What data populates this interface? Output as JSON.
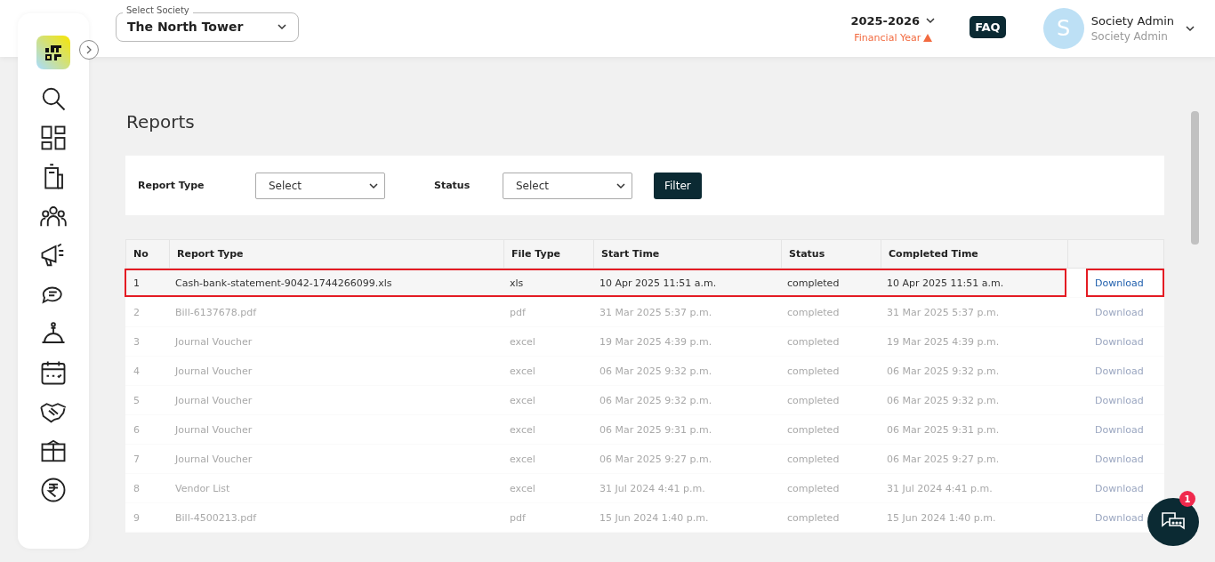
{
  "header": {
    "society_label": "Select Society",
    "society_value": "The North Tower",
    "year": "2025-2026",
    "year_caption": "Financial Year",
    "faq": "FAQ",
    "avatar_letter": "S",
    "user_name": "Society Admin",
    "user_role": "Society Admin"
  },
  "page_title": "Reports",
  "filters": [
    {
      "label": "Report Type",
      "placeholder": "Select"
    },
    {
      "label": "Status",
      "placeholder": "Select"
    }
  ],
  "filter_button": "Filter",
  "table": {
    "columns": [
      "No",
      "Report Type",
      "File Type",
      "Start Time",
      "Status",
      "Completed Time"
    ],
    "rows": [
      {
        "no": "1",
        "report_type": "Cash-bank-statement-9042-1744266099.xls",
        "file_type": "xls",
        "start_time": "10 Apr 2025 11:51 a.m.",
        "status": "completed",
        "completed_time": "10 Apr 2025 11:51 a.m.",
        "action": "Download",
        "highlighted": true
      },
      {
        "no": "2",
        "report_type": "Bill-6137678.pdf",
        "file_type": "pdf",
        "start_time": "31 Mar 2025 5:37 p.m.",
        "status": "completed",
        "completed_time": "31 Mar 2025 5:37 p.m.",
        "action": "Download",
        "highlighted": false
      },
      {
        "no": "3",
        "report_type": "Journal Voucher",
        "file_type": "excel",
        "start_time": "19 Mar 2025 4:39 p.m.",
        "status": "completed",
        "completed_time": "19 Mar 2025 4:39 p.m.",
        "action": "Download",
        "highlighted": false
      },
      {
        "no": "4",
        "report_type": "Journal Voucher",
        "file_type": "excel",
        "start_time": "06 Mar 2025 9:32 p.m.",
        "status": "completed",
        "completed_time": "06 Mar 2025 9:32 p.m.",
        "action": "Download",
        "highlighted": false
      },
      {
        "no": "5",
        "report_type": "Journal Voucher",
        "file_type": "excel",
        "start_time": "06 Mar 2025 9:32 p.m.",
        "status": "completed",
        "completed_time": "06 Mar 2025 9:32 p.m.",
        "action": "Download",
        "highlighted": false
      },
      {
        "no": "6",
        "report_type": "Journal Voucher",
        "file_type": "excel",
        "start_time": "06 Mar 2025 9:31 p.m.",
        "status": "completed",
        "completed_time": "06 Mar 2025 9:31 p.m.",
        "action": "Download",
        "highlighted": false
      },
      {
        "no": "7",
        "report_type": "Journal Voucher",
        "file_type": "excel",
        "start_time": "06 Mar 2025 9:27 p.m.",
        "status": "completed",
        "completed_time": "06 Mar 2025 9:27 p.m.",
        "action": "Download",
        "highlighted": false
      },
      {
        "no": "8",
        "report_type": "Vendor List",
        "file_type": "excel",
        "start_time": "31 Jul 2024 4:41 p.m.",
        "status": "completed",
        "completed_time": "31 Jul 2024 4:41 p.m.",
        "action": "Download",
        "highlighted": false
      },
      {
        "no": "9",
        "report_type": "Bill-4500213.pdf",
        "file_type": "pdf",
        "start_time": "15 Jun 2024 1:40 p.m.",
        "status": "completed",
        "completed_time": "15 Jun 2024 1:40 p.m.",
        "action": "Download",
        "highlighted": false
      }
    ]
  },
  "chat_badge": "1"
}
